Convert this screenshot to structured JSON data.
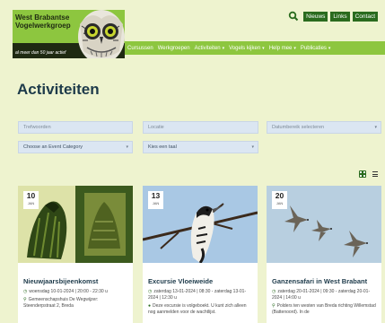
{
  "header": {
    "logo_title": "West Brabantse Vogelwerkgroep",
    "logo_slogan": "al meer dan 50 jaar actief",
    "util_links": [
      "Nieuws",
      "Links",
      "Contact"
    ]
  },
  "nav": {
    "items": [
      {
        "label": "Cursussen",
        "caret": false
      },
      {
        "label": "Werkgroepen",
        "caret": false
      },
      {
        "label": "Activiteiten",
        "caret": true
      },
      {
        "label": "Vogels kijken",
        "caret": true
      },
      {
        "label": "Help mee",
        "caret": true
      },
      {
        "label": "Publicaties",
        "caret": true
      }
    ]
  },
  "page": {
    "title": "Activiteiten"
  },
  "filters": {
    "keywords_placeholder": "Trefwoorden",
    "location_placeholder": "Locatie",
    "daterange_placeholder": "Datumbereik selecteren",
    "category_value": "Choose an Event Category",
    "language_value": "Kies een taal"
  },
  "cards": [
    {
      "day": "10",
      "month": "JAN",
      "title": "Nieuwjaarsbijeenkomst",
      "when": "woensdag 10-01-2024 | 20:00 - 22:30 u",
      "where": "Gemeenschapshuis De Wegwijzer: Steenderpstraat 2, Breda"
    },
    {
      "day": "13",
      "month": "JAN",
      "title": "Excursie Vloeiweide",
      "when": "zaterdag 13-01-2024 | 08:30 - zaterdag 13-01-2024 | 12:30 u",
      "desc": "Deze excursie is volgeboekt. U kunt zich alleen nog aanmelden voor de wachtlijst."
    },
    {
      "day": "20",
      "month": "JAN",
      "title": "Ganzensafari in West Brabant",
      "when": "zaterdag 20-01-2024 | 09:30 - zaterdag 20-01-2024 | 14:00 u",
      "where": "Polders ten westen van Breda richting Willemstad (Battenoord). In de"
    }
  ],
  "colors": {
    "background": "#eef3cf",
    "brand_green": "#8dc63f",
    "dark_green": "#2a6b1e",
    "title_blue": "#1d3a4a"
  }
}
